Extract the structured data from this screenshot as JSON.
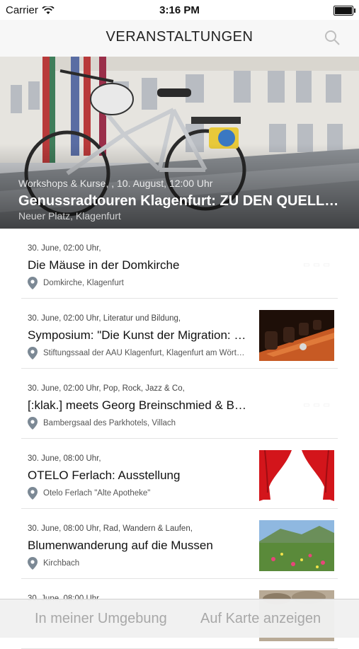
{
  "status": {
    "carrier": "Carrier",
    "time": "3:16 PM"
  },
  "nav": {
    "title": "VERANSTALTUNGEN"
  },
  "hero": {
    "meta": "Workshops & Kurse, , 10. August, 12:00 Uhr",
    "title": "Genussradtouren Klagenfurt: ZU DEN QUELLEN",
    "location": "Neuer Platz, Klagenfurt"
  },
  "events": [
    {
      "date": "30. June, 02:00 Uhr,",
      "title": "Die Mäuse in der Domkirche",
      "location": "Domkirche, Klagenfurt",
      "image": "none"
    },
    {
      "date": "30. June, 02:00 Uhr, Literatur und Bildung,",
      "title": "Symposium: \"Die Kunst der Migration: Sprache, Literatur",
      "location": "Stiftungssaal der AAU Klagenfurt, Klagenfurt am Wörthersee",
      "image": "conference"
    },
    {
      "date": "30. June, 02:00 Uhr, Pop, Rock, Jazz & Co,",
      "title": "[:klak.] meets Georg Breinschmied & Benjamin",
      "location": "Bambergsaal des Parkhotels, Villach",
      "image": "none"
    },
    {
      "date": "30. June, 08:00 Uhr,",
      "title": "OTELO Ferlach: Ausstellung",
      "location": "Otelo Ferlach \"Alte Apotheke\"",
      "image": "curtain"
    },
    {
      "date": "30. June, 08:00 Uhr, Rad, Wandern & Laufen,",
      "title": "Blumenwanderung auf die Mussen",
      "location": "Kirchbach",
      "image": "meadow"
    },
    {
      "date": "30. June, 08:00 Uhr",
      "title": "",
      "location": "",
      "image": "stones"
    }
  ],
  "toolbar": {
    "nearby": "In meiner Umgebung",
    "map": "Auf Karte anzeigen"
  },
  "icons": {
    "search": "search-icon",
    "pin": "location-pin-icon",
    "wifi": "wifi-icon",
    "battery": "battery-icon"
  }
}
